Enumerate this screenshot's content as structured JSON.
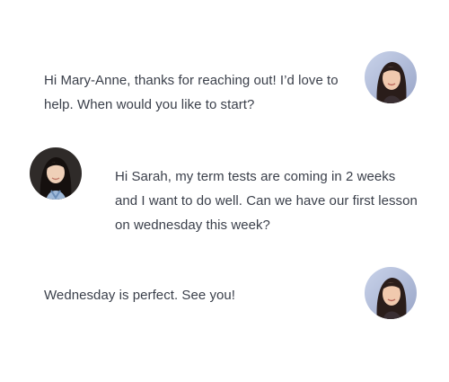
{
  "messages": [
    {
      "id": "m1",
      "side": "tutor",
      "avatar_icon": "tutor-avatar",
      "text": "Hi Mary-Anne, thanks for reaching out! I’d love to help. When would you like to start?"
    },
    {
      "id": "m2",
      "side": "student",
      "avatar_icon": "student-avatar",
      "text": "Hi Sarah, my term tests are coming in 2 weeks and I want to do well. Can we have our first lesson on wednesday this week?"
    },
    {
      "id": "m3",
      "side": "tutor",
      "avatar_icon": "tutor-avatar",
      "text": "Wednesday is perfect. See you!"
    }
  ],
  "colors": {
    "text": "#3a3f4a",
    "background": "#ffffff"
  }
}
